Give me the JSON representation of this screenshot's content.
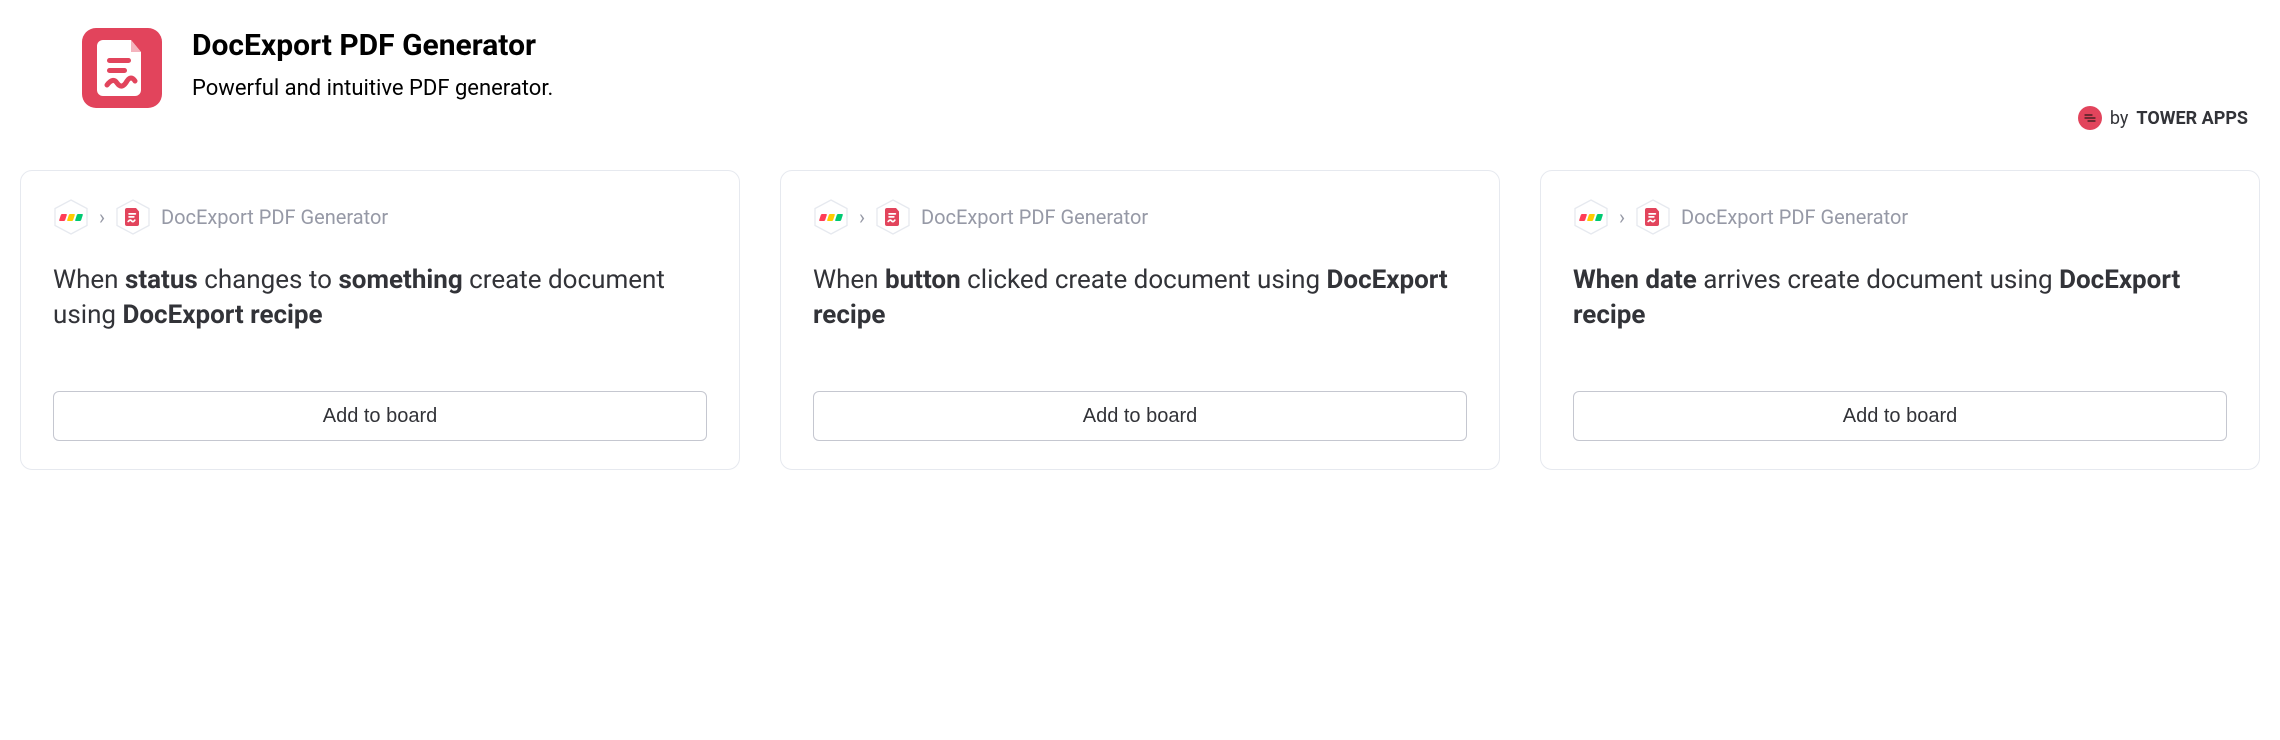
{
  "header": {
    "title": "DocExport PDF Generator",
    "subtitle": "Powerful and intuitive PDF generator.",
    "vendor_by": "by",
    "vendor_name": "TOWER APPS"
  },
  "path_label": "DocExport PDF Generator",
  "cards": [
    {
      "title_html": "When <b>status</b> changes to <b>something</b> create document using <b>DocExport recipe</b>",
      "button": "Add to board"
    },
    {
      "title_html": "When <b>button</b> clicked create document using <b>DocExport recipe</b>",
      "button": "Add to board"
    },
    {
      "title_html": "<b>When date</b> arrives create document using <b>DocExport recipe</b>",
      "button": "Add to board"
    }
  ]
}
